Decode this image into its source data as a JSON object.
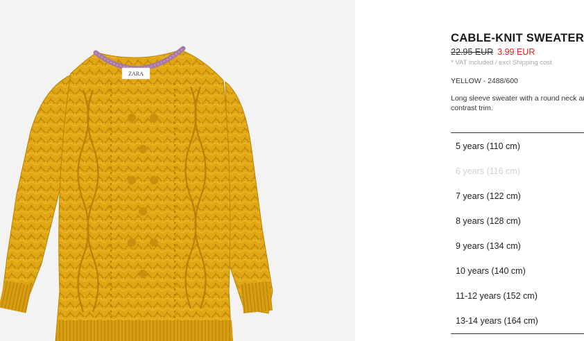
{
  "product": {
    "title": "CABLE-KNIT SWEATER",
    "old_price": "22.95 EUR",
    "new_price": "3.99 EUR",
    "vat_note": "* VAT included / excl Shipping cost",
    "color_ref": "YELLOW - 2488/600",
    "description": "Long sleeve sweater with a round neck and contrast trim.",
    "image": {
      "label_text": "ZARA",
      "colors": {
        "background": "#f3f3f3",
        "sweater": "#e0a614",
        "sweater_dark": "#c18a0b",
        "sweater_light": "#f0bd2c",
        "neck_trim": "#a77aa4"
      }
    }
  },
  "sizes": [
    {
      "label": "5 years (110 cm)",
      "available": true
    },
    {
      "label": "6 years (116 cm)",
      "available": false
    },
    {
      "label": "7 years (122 cm)",
      "available": true
    },
    {
      "label": "8 years (128 cm)",
      "available": true
    },
    {
      "label": "9 years (134 cm)",
      "available": true
    },
    {
      "label": "10 years (140 cm)",
      "available": true
    },
    {
      "label": "11-12 years (152 cm)",
      "available": true
    },
    {
      "label": "13-14 years (164 cm)",
      "available": true
    }
  ],
  "colors": {
    "sale_red": "#e0231b",
    "muted_text": "#a9a9a9",
    "disabled_text": "#d2d2d2"
  }
}
